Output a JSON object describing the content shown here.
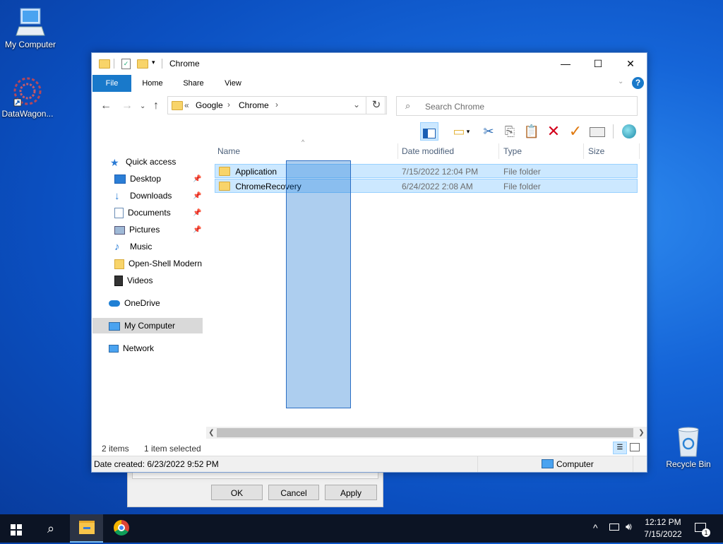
{
  "desktop": {
    "icons": [
      {
        "label": "My Computer"
      },
      {
        "label": "DataWagon..."
      },
      {
        "label": "Recycle Bin"
      }
    ]
  },
  "background_dialog": {
    "ok": "OK",
    "cancel": "Cancel",
    "apply": "Apply"
  },
  "window": {
    "title": "Chrome",
    "controls": {
      "minimize": "—",
      "maximize": "☐",
      "close": "✕"
    },
    "ribbon_tabs": [
      "File",
      "Home",
      "Share",
      "View"
    ],
    "breadcrumb": {
      "prefix": "«",
      "items": [
        "Google",
        "Chrome"
      ]
    },
    "search_placeholder": "Search Chrome",
    "sidebar": {
      "quick_access": "Quick access",
      "items": [
        "Desktop",
        "Downloads",
        "Documents",
        "Pictures",
        "Music",
        "Open-Shell Modern",
        "Videos"
      ],
      "onedrive": "OneDrive",
      "my_computer": "My Computer",
      "network": "Network"
    },
    "columns": [
      "Name",
      "Date modified",
      "Type",
      "Size"
    ],
    "files": [
      {
        "name": "Application",
        "date": "7/15/2022 12:04 PM",
        "type": "File folder",
        "size": ""
      },
      {
        "name": "ChromeRecovery",
        "date": "6/24/2022 2:08 AM",
        "type": "File folder",
        "size": ""
      }
    ],
    "status": {
      "count": "2 items",
      "selected": "1 item selected"
    },
    "details": {
      "created": "Date created: 6/23/2022 9:52 PM",
      "location": "Computer"
    }
  },
  "taskbar": {
    "time": "12:12 PM",
    "date": "7/15/2022",
    "notification_count": "1"
  },
  "colors": {
    "accent": "#1979ca",
    "selection": "#cce8ff",
    "taskbar": "#0c1424"
  }
}
